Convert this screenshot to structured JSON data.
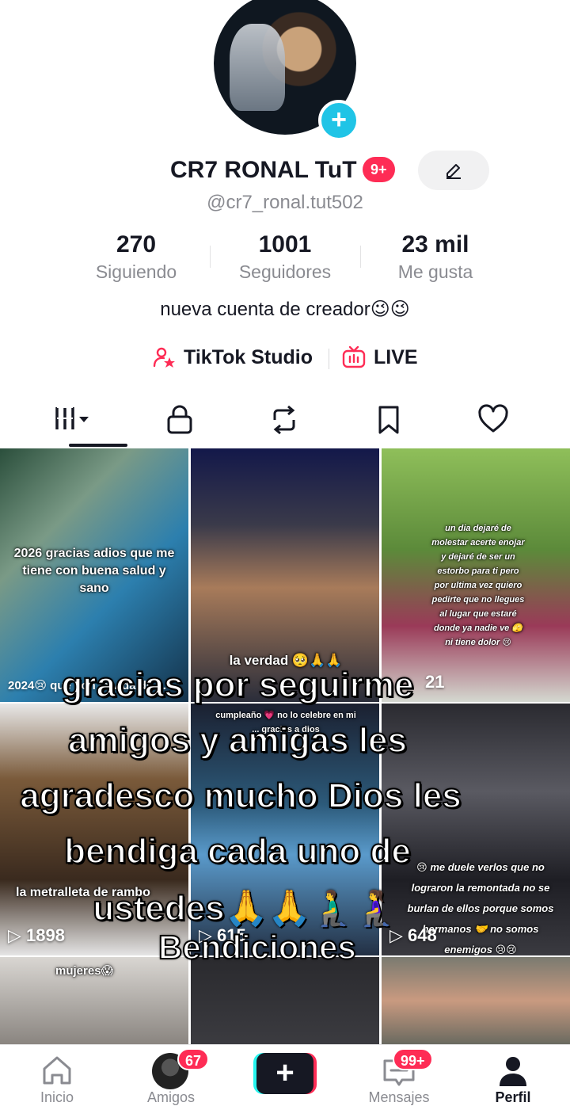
{
  "profile": {
    "display_name": "CR7 RONAL TuT",
    "name_badge": "9+",
    "handle": "@cr7_ronal.tut502",
    "bio": "nueva cuenta de creador😉😉",
    "avatar_badge": "+"
  },
  "stats": [
    {
      "value": "270",
      "label": "Siguiendo"
    },
    {
      "value": "1001",
      "label": "Seguidores"
    },
    {
      "value": "23 mil",
      "label": "Me gusta"
    }
  ],
  "links": {
    "studio": "TikTok Studio",
    "live": "LIVE"
  },
  "tabs": [
    {
      "icon": "grid-icon",
      "active": true
    },
    {
      "icon": "lock-icon"
    },
    {
      "icon": "repost-icon"
    },
    {
      "icon": "bookmark-icon"
    },
    {
      "icon": "heart-icon"
    }
  ],
  "videos": [
    {
      "caption": "2026 gracias adios que me tiene con buena salud y sano",
      "views": "2024😢 qué con la vida de ..."
    },
    {
      "caption": "la verdad 🥺🙏🙏",
      "views": ""
    },
    {
      "caption": "un dia dejaré de molestar acerte enojar y dejaré de ser un estorbo para ti pero por ultima vez quiero pedirte que no llegues al lugar que estaré donde ya nadie ve 🫣 ni tiene dolor 😢",
      "views": "21"
    },
    {
      "caption": "la metralleta de rambo",
      "views": "1898"
    },
    {
      "caption": "cumpleaño 💗 no lo celebre en mi ... gracias a dios",
      "views": "615"
    },
    {
      "caption": "😢 me duele verlos que no lograron la remontada no se burlan de ellos porque somos hermanos 🤝 no somos enemigos 😢😢",
      "views": "648"
    },
    {
      "caption": "mujeres😱",
      "views": ""
    },
    {
      "caption": "",
      "views": ""
    },
    {
      "caption": "",
      "views": ""
    }
  ],
  "overlay": {
    "lines": [
      "gracias por seguirme",
      "amigos y amigas les",
      "agradesco mucho Dios les",
      "bendiga cada uno de",
      "ustedes🙏🙏🧎‍♂️🧎‍♀️"
    ],
    "sign": "Bendiciones"
  },
  "nav": {
    "home": "Inicio",
    "friends": "Amigos",
    "friends_badge": "67",
    "create": "+",
    "inbox": "Mensajes",
    "inbox_badge": "99+",
    "profile": "Perfil"
  },
  "colors": {
    "accent": "#fe2c55",
    "cyan": "#25f4ee",
    "text": "#161823",
    "muted": "#8a8b91"
  }
}
